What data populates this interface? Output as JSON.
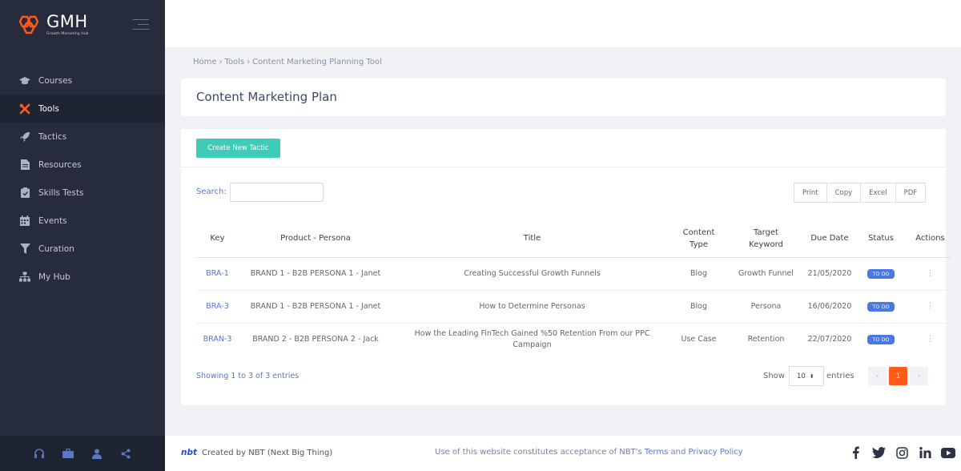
{
  "brand": {
    "name": "GMH",
    "tagline": "Growth Marketing Hub"
  },
  "sidebar": {
    "items": [
      {
        "label": "Courses",
        "icon": "graduation-cap-icon",
        "active": false
      },
      {
        "label": "Tools",
        "icon": "tools-icon",
        "active": true
      },
      {
        "label": "Tactics",
        "icon": "rocket-icon",
        "active": false
      },
      {
        "label": "Resources",
        "icon": "document-icon",
        "active": false
      },
      {
        "label": "Skills Tests",
        "icon": "clipboard-check-icon",
        "active": false
      },
      {
        "label": "Events",
        "icon": "calendar-icon",
        "active": false
      },
      {
        "label": "Curation",
        "icon": "filter-icon",
        "active": false
      },
      {
        "label": "My Hub",
        "icon": "sitemap-icon",
        "active": false
      }
    ],
    "bottom_icons": [
      "headset-icon",
      "briefcase-icon",
      "user-icon",
      "share-icon"
    ]
  },
  "breadcrumb": {
    "home": "Home",
    "tools": "Tools",
    "current": "Content Marketing Planning Tool"
  },
  "page": {
    "title": "Content Marketing Plan"
  },
  "toolbar": {
    "create_label": "Create New Tactic"
  },
  "search": {
    "label": "Search:",
    "value": ""
  },
  "export": {
    "print": "Print",
    "copy": "Copy",
    "excel": "Excel",
    "pdf": "PDF"
  },
  "table": {
    "headers": [
      "Key",
      "Product - Persona",
      "Title",
      "Content Type",
      "Target Keyword",
      "Due Date",
      "Status",
      "Actions"
    ],
    "rows": [
      {
        "key": "BRA-1",
        "persona": "BRAND 1 - B2B PERSONA 1 - Janet",
        "title": "Creating Successful Growth Funnels",
        "type": "Blog",
        "keyword": "Growth Funnel",
        "due": "21/05/2020",
        "status": "TO DO",
        "actions": "⋮"
      },
      {
        "key": "BRA-3",
        "persona": "BRAND 1 - B2B PERSONA 1 - Janet",
        "title": "How to Determine Personas",
        "type": "Blog",
        "keyword": "Persona",
        "due": "16/06/2020",
        "status": "TO DO",
        "actions": "⋮"
      },
      {
        "key": "BRAN-3",
        "persona": "BRAND 2 - B2B PERSONA 2 - Jack",
        "title": "How the Leading FinTech Gained %50 Retention From our PPC Campaign",
        "type": "Use Case",
        "keyword": "Retention",
        "due": "22/07/2020",
        "status": "TO DO",
        "actions": "⋮"
      }
    ]
  },
  "pagination": {
    "info": "Showing 1 to 3 of 3 entries",
    "show_label": "Show",
    "page_size": "10",
    "entries_label": "entries",
    "prev": "‹",
    "current": "1",
    "next": "›"
  },
  "footer": {
    "logo": "nbt",
    "credit": "Created by  NBT (Next Big Thing)",
    "legal_prefix": "Use of this website constitutes acceptance of NBT's ",
    "terms": "Terms",
    "and": " and ",
    "privacy": "Privacy Policy",
    "socials": [
      "facebook-icon",
      "twitter-icon",
      "instagram-icon",
      "linkedin-icon",
      "youtube-icon"
    ]
  },
  "colors": {
    "sidebar": "#262c3c",
    "accent_teal": "#3ecbb8",
    "status_blue": "#4a78e0",
    "pager_active": "#ff5a1a",
    "link_blue": "#5b77c8"
  }
}
